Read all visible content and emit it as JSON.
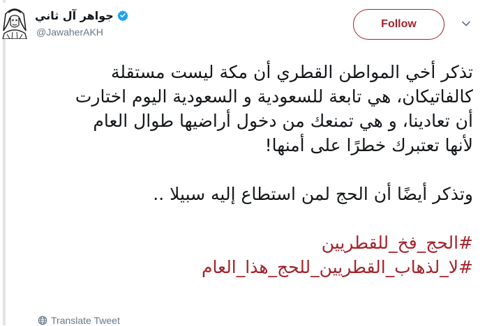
{
  "header": {
    "display_name": "جواهر آل ثاني",
    "handle": "@JawaherAKH",
    "verified_icon": "verified-badge-icon",
    "follow_label": "Follow",
    "accent_color": "#a4222a"
  },
  "tweet": {
    "lines": [
      "تذكر أخي المواطن القطري أن مكة ليست مستقلة",
      "كالفاتيكان، هي تابعة للسعودية و السعودية اليوم اختارت",
      "أن تعادينا، و هي تمنعك من دخول أراضيها طوال العام",
      "لأنها تعتبرك خطرًا على أمنها!",
      "وتذكر أيضًا أن الحج لمن استطاع إليه سبيلا .."
    ],
    "hashtags": [
      "#الحج_فخ_للقطريين",
      "#لا_لذهاب_القطريين_للحج_هذا_العام"
    ]
  },
  "footer": {
    "translate_label": "Translate Tweet",
    "translate_icon": "globe-icon"
  }
}
